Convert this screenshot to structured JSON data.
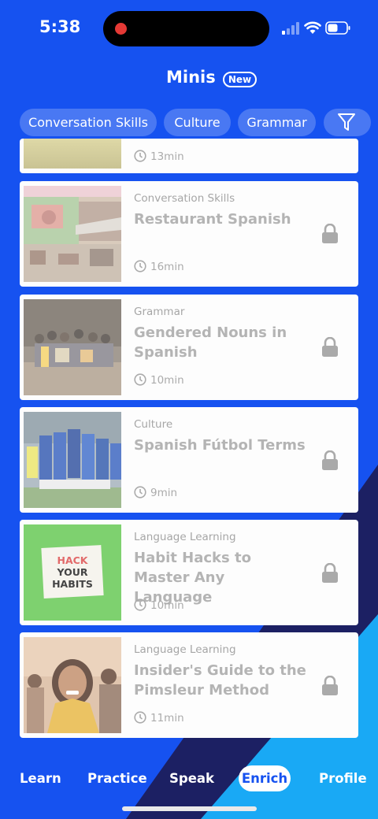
{
  "status_bar": {
    "time": "5:38"
  },
  "header": {
    "title": "Minis",
    "badge": "New"
  },
  "chips": [
    "Conversation Skills",
    "Culture",
    "Grammar"
  ],
  "partial_card": {
    "duration": "13min"
  },
  "cards": [
    {
      "category": "Conversation Skills",
      "title": "Restaurant Spanish",
      "duration": "16min",
      "thumb": "restaurant-photo"
    },
    {
      "category": "Grammar",
      "title": "Gendered Nouns in Spanish",
      "duration": "10min",
      "thumb": "group-photo"
    },
    {
      "category": "Culture",
      "title": "Spanish Fútbol Terms",
      "duration": "9min",
      "thumb": "football-team-photo"
    },
    {
      "category": "Language Learning",
      "title": "Habit Hacks to Master Any Language",
      "duration": "10min",
      "thumb": "hack-your-habits-photo",
      "thumb_text": [
        "HACK",
        "YOUR",
        "HABITS"
      ]
    },
    {
      "category": "Language Learning",
      "title": "Insider's Guide to the Pimsleur Method",
      "duration": "11min",
      "thumb": "smiling-woman-photo"
    }
  ],
  "tabs": [
    {
      "label": "Learn"
    },
    {
      "label": "Practice"
    },
    {
      "label": "Speak"
    },
    {
      "label": "Enrich",
      "active": true
    },
    {
      "label": "Profile"
    }
  ],
  "colors": {
    "brand_blue": "#1652f0",
    "dark_navy": "#1c2063",
    "light_blue": "#19a9f5"
  }
}
